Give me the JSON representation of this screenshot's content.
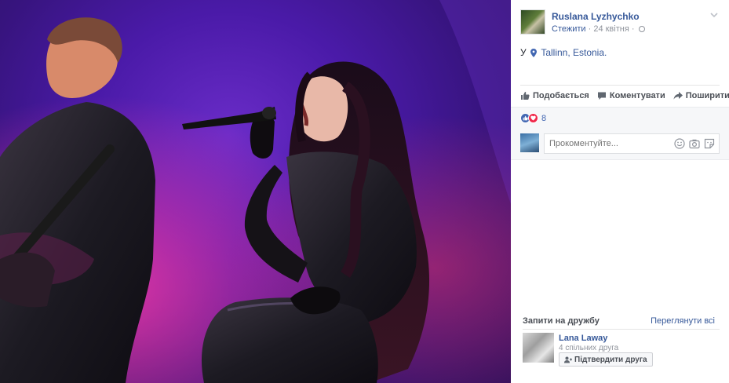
{
  "post": {
    "author": "Ruslana Lyzhychko",
    "follow": "Стежити",
    "separator": " · ",
    "date": "24 квітня",
    "location_prefix": "У",
    "location": "Tallinn, Estonia.",
    "actions": {
      "like": "Подобається",
      "comment": "Коментувати",
      "share": "Поширити"
    },
    "reaction_count": "8",
    "comment_placeholder": "Прокоментуйте..."
  },
  "friend_requests": {
    "title": "Запити на дружбу",
    "see_all": "Переглянути всі",
    "items": [
      {
        "name": "Lana Laway",
        "mutual": "4 спільних друга",
        "confirm": "Підтвердити друга"
      }
    ]
  },
  "colors": {
    "link": "#365899",
    "stage_purple": "#4a1aa8",
    "stage_magenta": "#c2339a"
  },
  "icons": [
    "chevron-down-icon",
    "globe-icon",
    "location-pin-icon",
    "like-icon",
    "comment-icon",
    "share-icon",
    "like-reaction-icon",
    "love-reaction-icon",
    "emoji-icon",
    "camera-icon",
    "sticker-icon",
    "add-friend-icon"
  ]
}
